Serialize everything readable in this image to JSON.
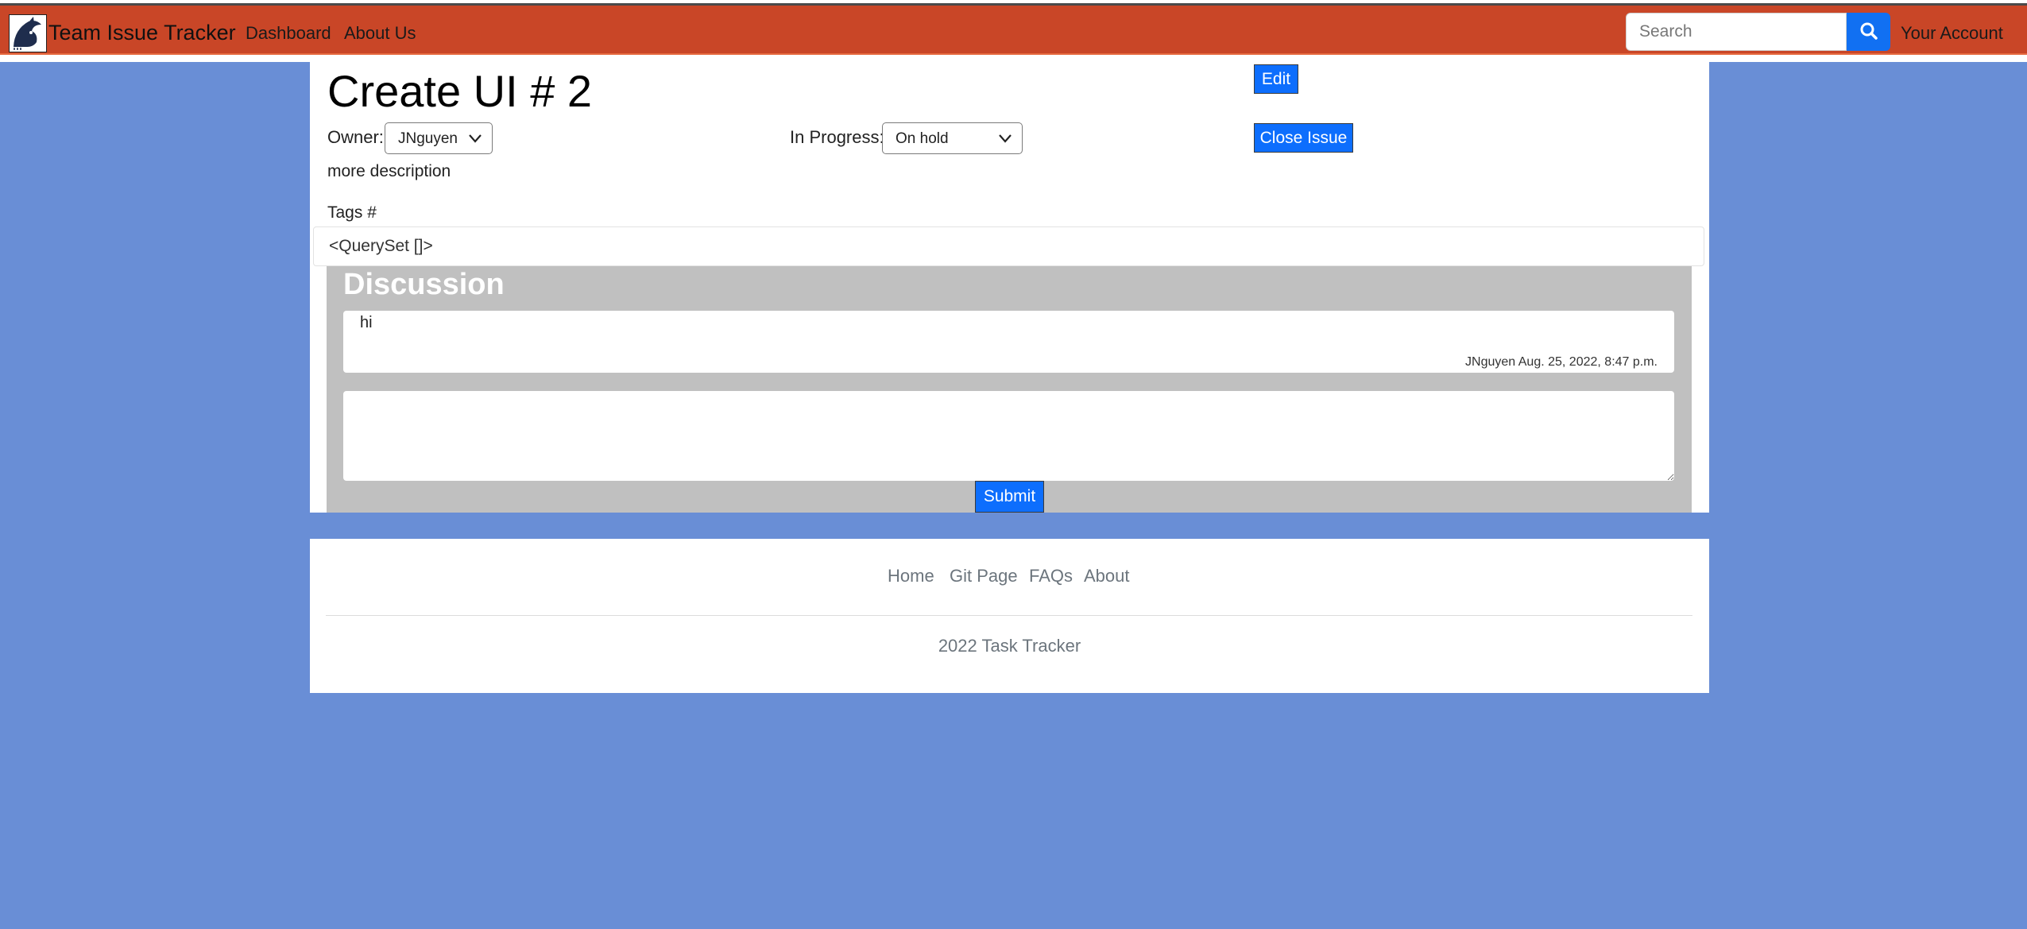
{
  "navbar": {
    "brand": "Team Issue Tracker",
    "links": [
      "Dashboard",
      "About Us"
    ],
    "search_placeholder": "Search",
    "account": "Your Account",
    "accent": "#c94627"
  },
  "issue": {
    "title": "Create UI # 2",
    "edit_label": "Edit",
    "close_label": "Close Issue",
    "owner_label": "Owner:",
    "owner_value": "JNguyen",
    "progress_label": "In Progress:",
    "progress_value": "On hold",
    "description": "more description",
    "tags_label": "Tags #",
    "tags_value": "<QuerySet []>"
  },
  "discussion": {
    "title": "Discussion",
    "comments": [
      {
        "body": "hi",
        "meta": "JNguyen Aug. 25, 2022, 8:47 p.m."
      }
    ],
    "submit_label": "Submit"
  },
  "footer": {
    "links": [
      "Home",
      "Git Page",
      "FAQs",
      "About"
    ],
    "copyright": "2022 Task Tracker"
  },
  "colors": {
    "page_background": "#698ed6",
    "button_blue": "#0d6efd",
    "discussion_background": "#c0c0c0"
  }
}
